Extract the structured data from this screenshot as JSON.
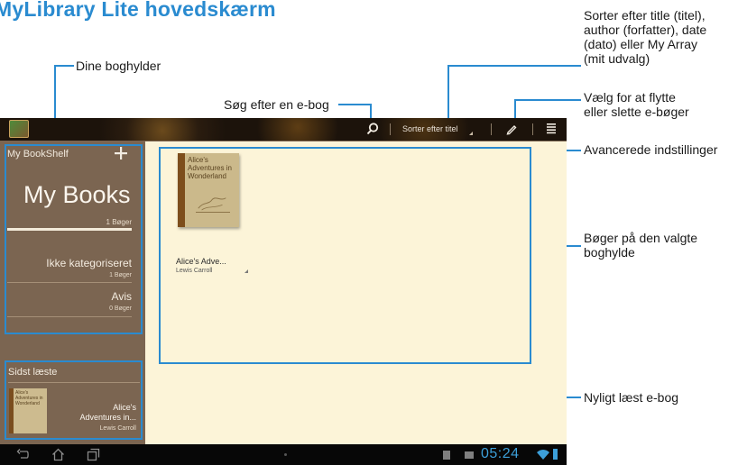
{
  "title": "MyLibrary Lite hovedskærm",
  "callouts": {
    "bookshelves": "Dine boghylder",
    "search": "Søg efter en e-bog",
    "sort": [
      "Sorter efter title (titel),",
      "author (forfatter), date",
      "(dato) eller My Array",
      "(mit udvalg)"
    ],
    "edit": [
      "Vælg for at flytte",
      "eller slette e-bøger"
    ],
    "advanced": "Avancerede indstillinger",
    "books_on_shelf": [
      "Bøger på den valgte",
      "boghylde"
    ],
    "recent_book": "Nyligt læst e-bog"
  },
  "toolbar": {
    "sort_label": "Sorter efter titel",
    "icons": [
      "app-icon",
      "search-icon",
      "edit-icon",
      "menu-icon"
    ]
  },
  "sidebar": {
    "header": "My BookShelf",
    "add_icon": "plus-icon",
    "selected": {
      "name": "My Books",
      "count": "1 Bøger"
    },
    "items": [
      {
        "name": "Ikke kategoriseret",
        "count": "1 Bøger"
      },
      {
        "name": "Avis",
        "count": "0 Bøger"
      }
    ]
  },
  "recent": {
    "header": "Sidst læste",
    "cover_text": "Alice's Adventures in Wonderland",
    "title_line1": "Alice's",
    "title_line2": "Adventures in...",
    "author": "Lewis Carroll"
  },
  "shelf": {
    "book": {
      "cover_text": "Alice's Adventures in Wonderland",
      "label": "Alice's Adve...",
      "author": "Lewis Carroll"
    }
  },
  "navbar": {
    "time": "05:24",
    "icons": [
      "back-icon",
      "home-icon",
      "recent-apps-icon",
      "notification-icon",
      "image-icon",
      "wifi-icon",
      "battery-icon"
    ]
  },
  "colors": {
    "accent": "#2a8bd0",
    "shelf_background": "#fcf4d8",
    "sidebar_background": "#7b6551",
    "clock": "#3c9fd9"
  }
}
